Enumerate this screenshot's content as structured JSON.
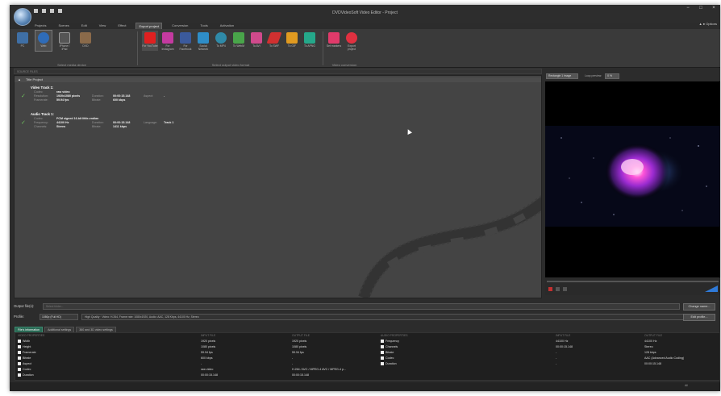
{
  "window": {
    "title": "DVDVideoSoft Video Editor - Project",
    "controls": [
      "−",
      "□",
      "×"
    ]
  },
  "menu": {
    "items": [
      {
        "label": "Projects",
        "active": false
      },
      {
        "label": "Scenes",
        "active": false
      },
      {
        "label": "Edit",
        "active": false
      },
      {
        "label": "View",
        "active": false
      },
      {
        "label": "Effect",
        "active": false
      },
      {
        "label": "Export project",
        "active": true
      },
      {
        "label": "Conversion",
        "active": false
      },
      {
        "label": "Tools",
        "active": false
      },
      {
        "label": "Activation",
        "active": false
      }
    ],
    "options_label": "Options"
  },
  "ribbon": {
    "groups": [
      {
        "label": "Select media device",
        "buttons": [
          {
            "label": "PC",
            "icon": "pc-icon",
            "color": "#3f6fa5"
          },
          {
            "label": "Web",
            "icon": "globe-icon",
            "color": "#2f6cb8"
          },
          {
            "label": "iPhone / iPad",
            "icon": "phone-icon",
            "color": "#555555"
          },
          {
            "label": "DVD",
            "icon": "dvd-icon",
            "color": "#8a6a4a"
          }
        ]
      },
      {
        "label": "Select output video format",
        "buttons": [
          {
            "label": "For YouTube",
            "icon": "youtube-icon",
            "color": "#e02020"
          },
          {
            "label": "For Instagram",
            "icon": "instagram-icon",
            "color": "#c43aa0"
          },
          {
            "label": "For Facebook",
            "icon": "facebook-icon",
            "color": "#3b5a9c"
          },
          {
            "label": "Social Network",
            "icon": "social-network-icon",
            "color": "#2e8dc8"
          },
          {
            "label": "To MP4",
            "icon": "mp4-icon",
            "color": "#2f8aa8"
          },
          {
            "label": "To WebM",
            "icon": "webm-icon",
            "color": "#49a54a"
          },
          {
            "label": "To AVI",
            "icon": "avi-icon",
            "color": "#d04a8c"
          },
          {
            "label": "To SWF",
            "icon": "swf-icon",
            "color": "#d03030"
          },
          {
            "label": "To GIF",
            "icon": "gif-icon",
            "color": "#e09a20"
          },
          {
            "label": "To APNG",
            "icon": "apng-icon",
            "color": "#25a88a"
          }
        ]
      },
      {
        "label": "Video conversion",
        "buttons": [
          {
            "label": "Set markers",
            "icon": "markers-icon",
            "color": "#e03a6a"
          },
          {
            "label": "Export project",
            "icon": "export-icon",
            "color": "#e03040"
          }
        ]
      }
    ]
  },
  "source": {
    "header": "SOURCE FILES",
    "project_title": "Title Project",
    "video_track": {
      "title": "Video Track 1:",
      "codec_key": "Codec:",
      "codec_val": "raw video",
      "resolution_key": "Resolution:",
      "resolution_val": "1920x1080 pixels",
      "duration_key": "Duration:",
      "duration_val": "00:00:15.148",
      "aspect_key": "Aspect:",
      "aspect_val": "-",
      "framerate_key": "Framerate:",
      "framerate_val": "59.94 fps",
      "bitrate_key": "Bitrate:",
      "bitrate_val": "600 kbps"
    },
    "audio_track": {
      "title": "Audio Track 1:",
      "codec_key": "Codec:",
      "codec_val": "PCM signed 16-bit little-endian",
      "frequency_key": "Frequency:",
      "frequency_val": "44100 Hz",
      "duration_key": "Duration:",
      "duration_val": "00:00:15.148",
      "language_key": "Language:",
      "language_val": "Track 1",
      "channels_key": "Channels:",
      "channels_val": "Stereo",
      "bitrate_key": "Bitrate:",
      "bitrate_val": "1411 kbps"
    }
  },
  "preview": {
    "mode": "Rectangle 1 image",
    "zoom_label": "Loop preview:",
    "zoom_value": "0 %"
  },
  "output": {
    "folder_label": "Output file(s):",
    "folder_placeholder": "Select folder...",
    "change_button": "Change name...",
    "profile_label": "Profile:",
    "profile_value": "1080p (Full HD)",
    "profile_desc": "High Quality · Video: H.264, Frame rate: 1080x1920, Audio: AAC, 128 Kbps, 44100 Hz, Stereo",
    "edit_button": "Edit profile..."
  },
  "tabs": [
    {
      "label": "File's information",
      "active": true
    },
    {
      "label": "Additional settings",
      "active": false
    },
    {
      "label": "360 and 3D video settings",
      "active": false
    }
  ],
  "properties": {
    "video": {
      "header": "VIDEO PROPERTIES",
      "input_header": "INPUT FILE",
      "output_header": "OUTPUT FILE",
      "rows": [
        {
          "name": "Width",
          "input": "1920 pixels",
          "output": "1920 pixels"
        },
        {
          "name": "Height",
          "input": "1080 pixels",
          "output": "1080 pixels"
        },
        {
          "name": "Framerate",
          "input": "59.94 fps",
          "output": "59.94 fps"
        },
        {
          "name": "Bitrate",
          "input": "600 kbps",
          "output": "-"
        },
        {
          "name": "Aspect",
          "input": "-",
          "output": "-"
        },
        {
          "name": "Codec",
          "input": "raw video",
          "output": "H.264 / AVC / MPEG-4 AVC / MPEG-4 p..."
        },
        {
          "name": "Duration",
          "input": "00:00:15.148",
          "output": "00:00:15.148"
        }
      ]
    },
    "audio": {
      "header": "AUDIO PROPERTIES",
      "input_header": "INPUT FILE",
      "output_header": "OUTPUT FILE",
      "rows": [
        {
          "name": "Frequency",
          "input": "44100 Hz",
          "output": "44100 Hz"
        },
        {
          "name": "Channels",
          "input": "00:00:15.148",
          "output": "Stereo"
        },
        {
          "name": "Bitrate",
          "input": "-",
          "output": "128 kbps"
        },
        {
          "name": "Codec",
          "input": "-",
          "output": "AAC (Advanced Audio Coding)"
        },
        {
          "name": "Duration",
          "input": "-",
          "output": "00:00:15.148"
        }
      ]
    }
  },
  "status": {
    "text": "All"
  }
}
